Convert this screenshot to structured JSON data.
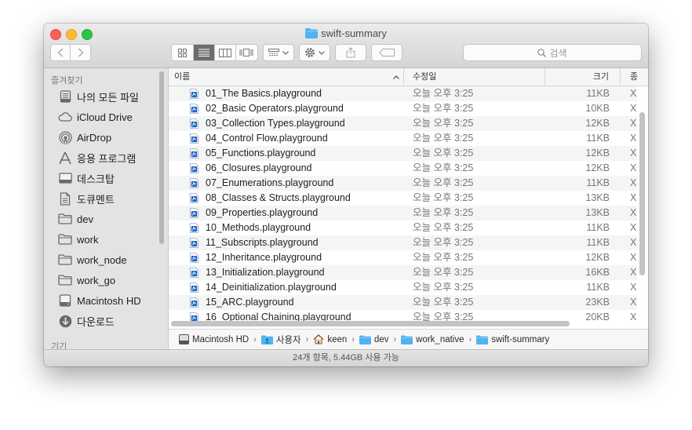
{
  "window": {
    "title": "swift-summary"
  },
  "toolbar": {
    "search_placeholder": "검색"
  },
  "sidebar": {
    "favorites_header": "즐겨찾기",
    "devices_header": "기기",
    "items": [
      {
        "label": "나의 모든 파일",
        "icon": "all-files-icon"
      },
      {
        "label": "iCloud Drive",
        "icon": "cloud-icon"
      },
      {
        "label": "AirDrop",
        "icon": "airdrop-icon"
      },
      {
        "label": "응용 프로그램",
        "icon": "applications-icon"
      },
      {
        "label": "데스크탑",
        "icon": "desktop-icon"
      },
      {
        "label": "도큐멘트",
        "icon": "document-icon"
      },
      {
        "label": "dev",
        "icon": "folder-icon"
      },
      {
        "label": "work",
        "icon": "folder-icon"
      },
      {
        "label": "work_node",
        "icon": "folder-icon"
      },
      {
        "label": "work_go",
        "icon": "folder-icon"
      },
      {
        "label": "Macintosh HD",
        "icon": "hard-drive-icon"
      },
      {
        "label": "다운로드",
        "icon": "download-icon"
      }
    ]
  },
  "columns": {
    "name": "이름",
    "date": "수정일",
    "size": "크기",
    "kind": "종"
  },
  "files": [
    {
      "name": "01_The Basics.playground",
      "date": "오늘 오후 3:25",
      "size": "11KB",
      "kind": "X"
    },
    {
      "name": "02_Basic Operators.playground",
      "date": "오늘 오후 3:25",
      "size": "10KB",
      "kind": "X"
    },
    {
      "name": "03_Collection Types.playground",
      "date": "오늘 오후 3:25",
      "size": "12KB",
      "kind": "X"
    },
    {
      "name": "04_Control Flow.playground",
      "date": "오늘 오후 3:25",
      "size": "11KB",
      "kind": "X"
    },
    {
      "name": "05_Functions.playground",
      "date": "오늘 오후 3:25",
      "size": "12KB",
      "kind": "X"
    },
    {
      "name": "06_Closures.playground",
      "date": "오늘 오후 3:25",
      "size": "12KB",
      "kind": "X"
    },
    {
      "name": "07_Enumerations.playground",
      "date": "오늘 오후 3:25",
      "size": "11KB",
      "kind": "X"
    },
    {
      "name": "08_Classes & Structs.playground",
      "date": "오늘 오후 3:25",
      "size": "13KB",
      "kind": "X"
    },
    {
      "name": "09_Properties.playground",
      "date": "오늘 오후 3:25",
      "size": "13KB",
      "kind": "X"
    },
    {
      "name": "10_Methods.playground",
      "date": "오늘 오후 3:25",
      "size": "11KB",
      "kind": "X"
    },
    {
      "name": "11_Subscripts.playground",
      "date": "오늘 오후 3:25",
      "size": "11KB",
      "kind": "X"
    },
    {
      "name": "12_Inheritance.playground",
      "date": "오늘 오후 3:25",
      "size": "12KB",
      "kind": "X"
    },
    {
      "name": "13_Initialization.playground",
      "date": "오늘 오후 3:25",
      "size": "16KB",
      "kind": "X"
    },
    {
      "name": "14_Deinitialization.playground",
      "date": "오늘 오후 3:25",
      "size": "11KB",
      "kind": "X"
    },
    {
      "name": "15_ARC.playground",
      "date": "오늘 오후 3:25",
      "size": "23KB",
      "kind": "X"
    },
    {
      "name": "16_Optional Chaining.playground",
      "date": "오늘 오후 3:25",
      "size": "20KB",
      "kind": "X"
    }
  ],
  "path": [
    "Macintosh HD",
    "사용자",
    "keen",
    "dev",
    "work_native",
    "swift-summary"
  ],
  "status": {
    "text": "24개 항목, 5.44GB 사용 가능"
  },
  "colors": {
    "folder": "#4fb3ee",
    "accent": "#6d6d6d",
    "playground_icon": "#1e66c8"
  }
}
